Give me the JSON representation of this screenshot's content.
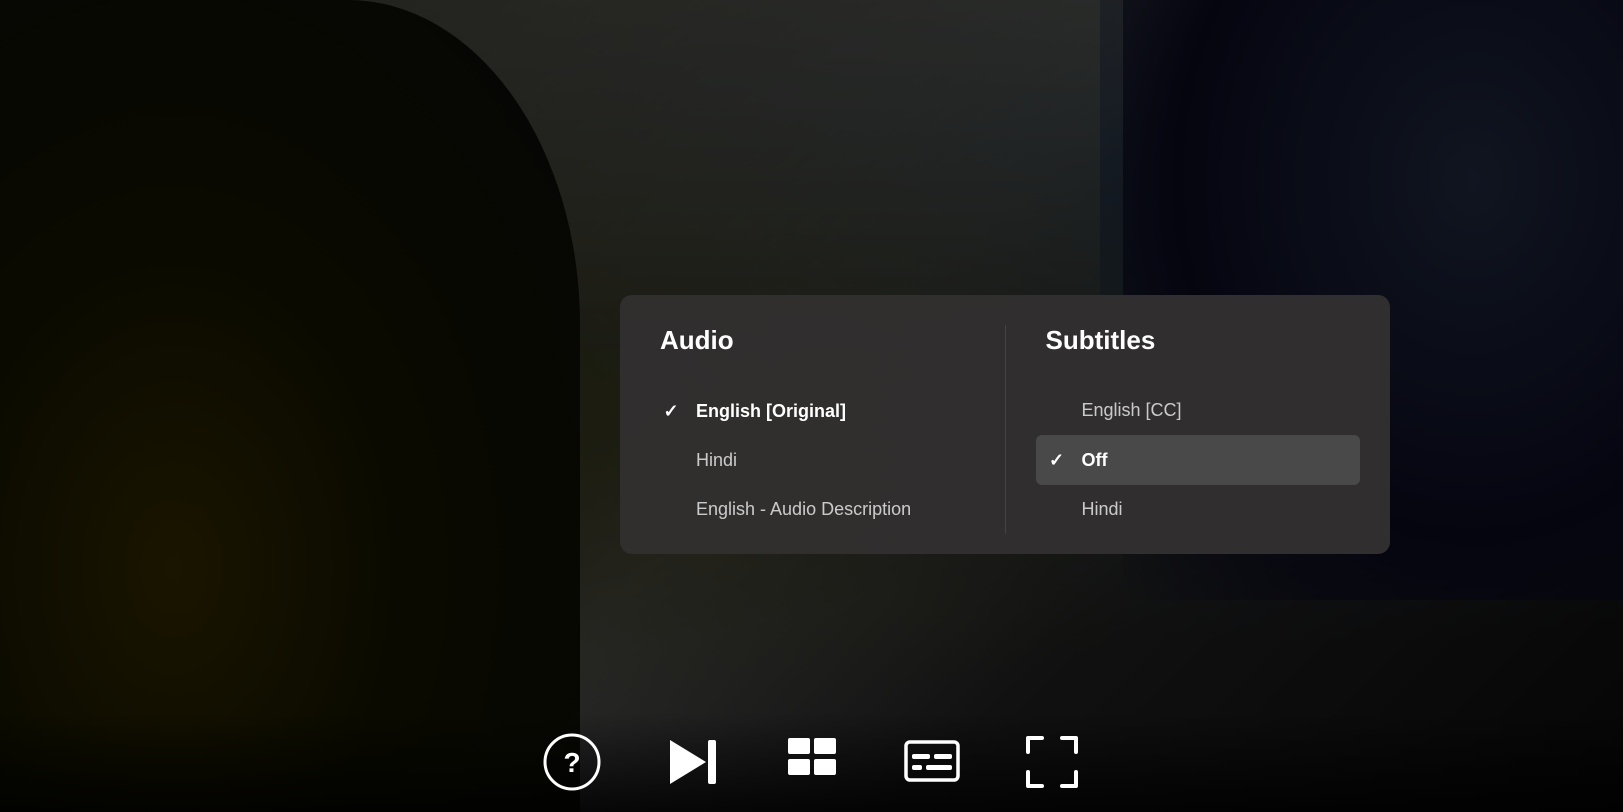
{
  "background": {
    "description": "Dark cinematic video scene"
  },
  "popup": {
    "audio": {
      "header": "Audio",
      "options": [
        {
          "label": "English [Original]",
          "selected": true,
          "highlighted": false
        },
        {
          "label": "Hindi",
          "selected": false,
          "highlighted": false
        },
        {
          "label": "English - Audio Description",
          "selected": false,
          "highlighted": false
        }
      ]
    },
    "subtitles": {
      "header": "Subtitles",
      "options": [
        {
          "label": "English [CC]",
          "selected": false,
          "highlighted": false
        },
        {
          "label": "Off",
          "selected": true,
          "highlighted": true
        },
        {
          "label": "Hindi",
          "selected": false,
          "highlighted": false
        }
      ]
    }
  },
  "controls": {
    "help_label": "help",
    "next_label": "next episode",
    "episodes_label": "episodes",
    "subtitles_label": "subtitles",
    "fullscreen_label": "fullscreen"
  }
}
